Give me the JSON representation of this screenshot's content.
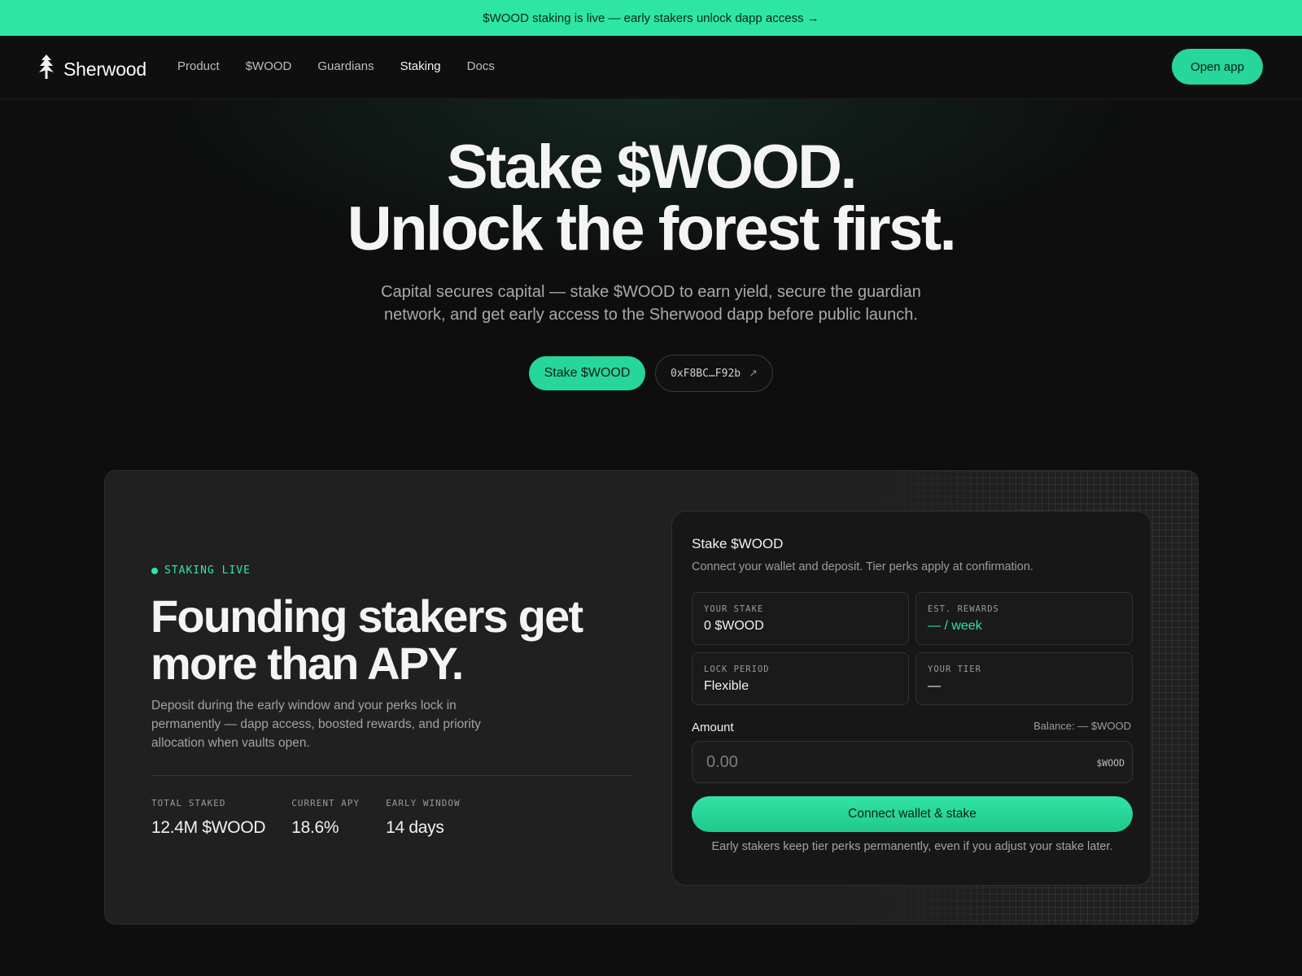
{
  "announcement": {
    "text": "$WOOD staking is live — early stakers unlock dapp access →"
  },
  "nav": {
    "logo": {
      "text": "Sherwood",
      "icon": "tree-logo-icon"
    },
    "links": [
      {
        "label": "Product",
        "active": false
      },
      {
        "label": "$WOOD",
        "active": false
      },
      {
        "label": "Guardians",
        "active": false
      },
      {
        "label": "Staking",
        "active": true
      },
      {
        "label": "Docs",
        "active": false
      }
    ],
    "cta": "Open app"
  },
  "hero": {
    "title_line1": "Stake $WOOD.",
    "title_line2": "Unlock the forest first.",
    "subtitle": "Capital secures capital — stake $WOOD to earn yield, secure the guardian network, and get early access to the Sherwood dapp before public launch.",
    "primary_button": "Stake $WOOD",
    "contract_address": "0xF8BC…F92b",
    "contract_icon": "external-link-icon"
  },
  "staking": {
    "badge": "STAKING LIVE",
    "title_line1": "Founding stakers get",
    "title_line2": "more than APY.",
    "description": "Deposit during the early window and your perks lock in permanently — dapp access, boosted rewards, and priority allocation when vaults open.",
    "stats": [
      {
        "label": "TOTAL STAKED",
        "value": "12.4M $WOOD"
      },
      {
        "label": "CURRENT APY",
        "value": "18.6%"
      },
      {
        "label": "EARLY WINDOW",
        "value": "14 days"
      }
    ],
    "card": {
      "title": "Stake $WOOD",
      "subtitle": "Connect your wallet and deposit. Tier perks apply at confirmation.",
      "tiles": [
        {
          "label": "YOUR STAKE",
          "value": "0 $WOOD"
        },
        {
          "label": "EST. REWARDS",
          "value": "— / week"
        },
        {
          "label": "LOCK PERIOD",
          "value": "Flexible"
        },
        {
          "label": "YOUR TIER",
          "value": "—"
        }
      ],
      "amount_label": "Amount",
      "balance": "Balance: — $WOOD",
      "amount_placeholder": "0.00",
      "amount_unit": "$WOOD",
      "button": "Connect wallet & stake",
      "note": "Early stakers keep tier perks permanently, even if you adjust your stake later."
    }
  },
  "colors": {
    "accent": "#2ee6a4",
    "background": "#0e0e0e",
    "panel": "#202020",
    "card": "#171717"
  }
}
